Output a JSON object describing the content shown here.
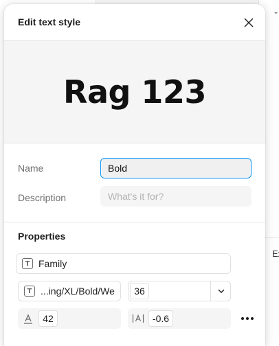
{
  "modal": {
    "title": "Edit text style"
  },
  "preview": {
    "sample_text": "Rag 123"
  },
  "form": {
    "name_label": "Name",
    "name_value": "Bold",
    "description_label": "Description",
    "description_placeholder": "What's it for?"
  },
  "properties": {
    "title": "Properties",
    "family_label": "Family",
    "style_value": "...ing/XL/Bold/We",
    "font_size": "36",
    "line_height": "42",
    "letter_spacing": "-0.6"
  },
  "background": {
    "side_text": "Ex"
  },
  "icons": {
    "close": "close-icon",
    "text_style": "text-style-icon",
    "chevron": "chevron-down-icon",
    "line_height": "line-height-icon",
    "letter_spacing": "letter-spacing-icon",
    "more": "more-icon"
  },
  "colors": {
    "accent_focus": "#0d99ff",
    "preview_bg": "#f5f5f5"
  }
}
